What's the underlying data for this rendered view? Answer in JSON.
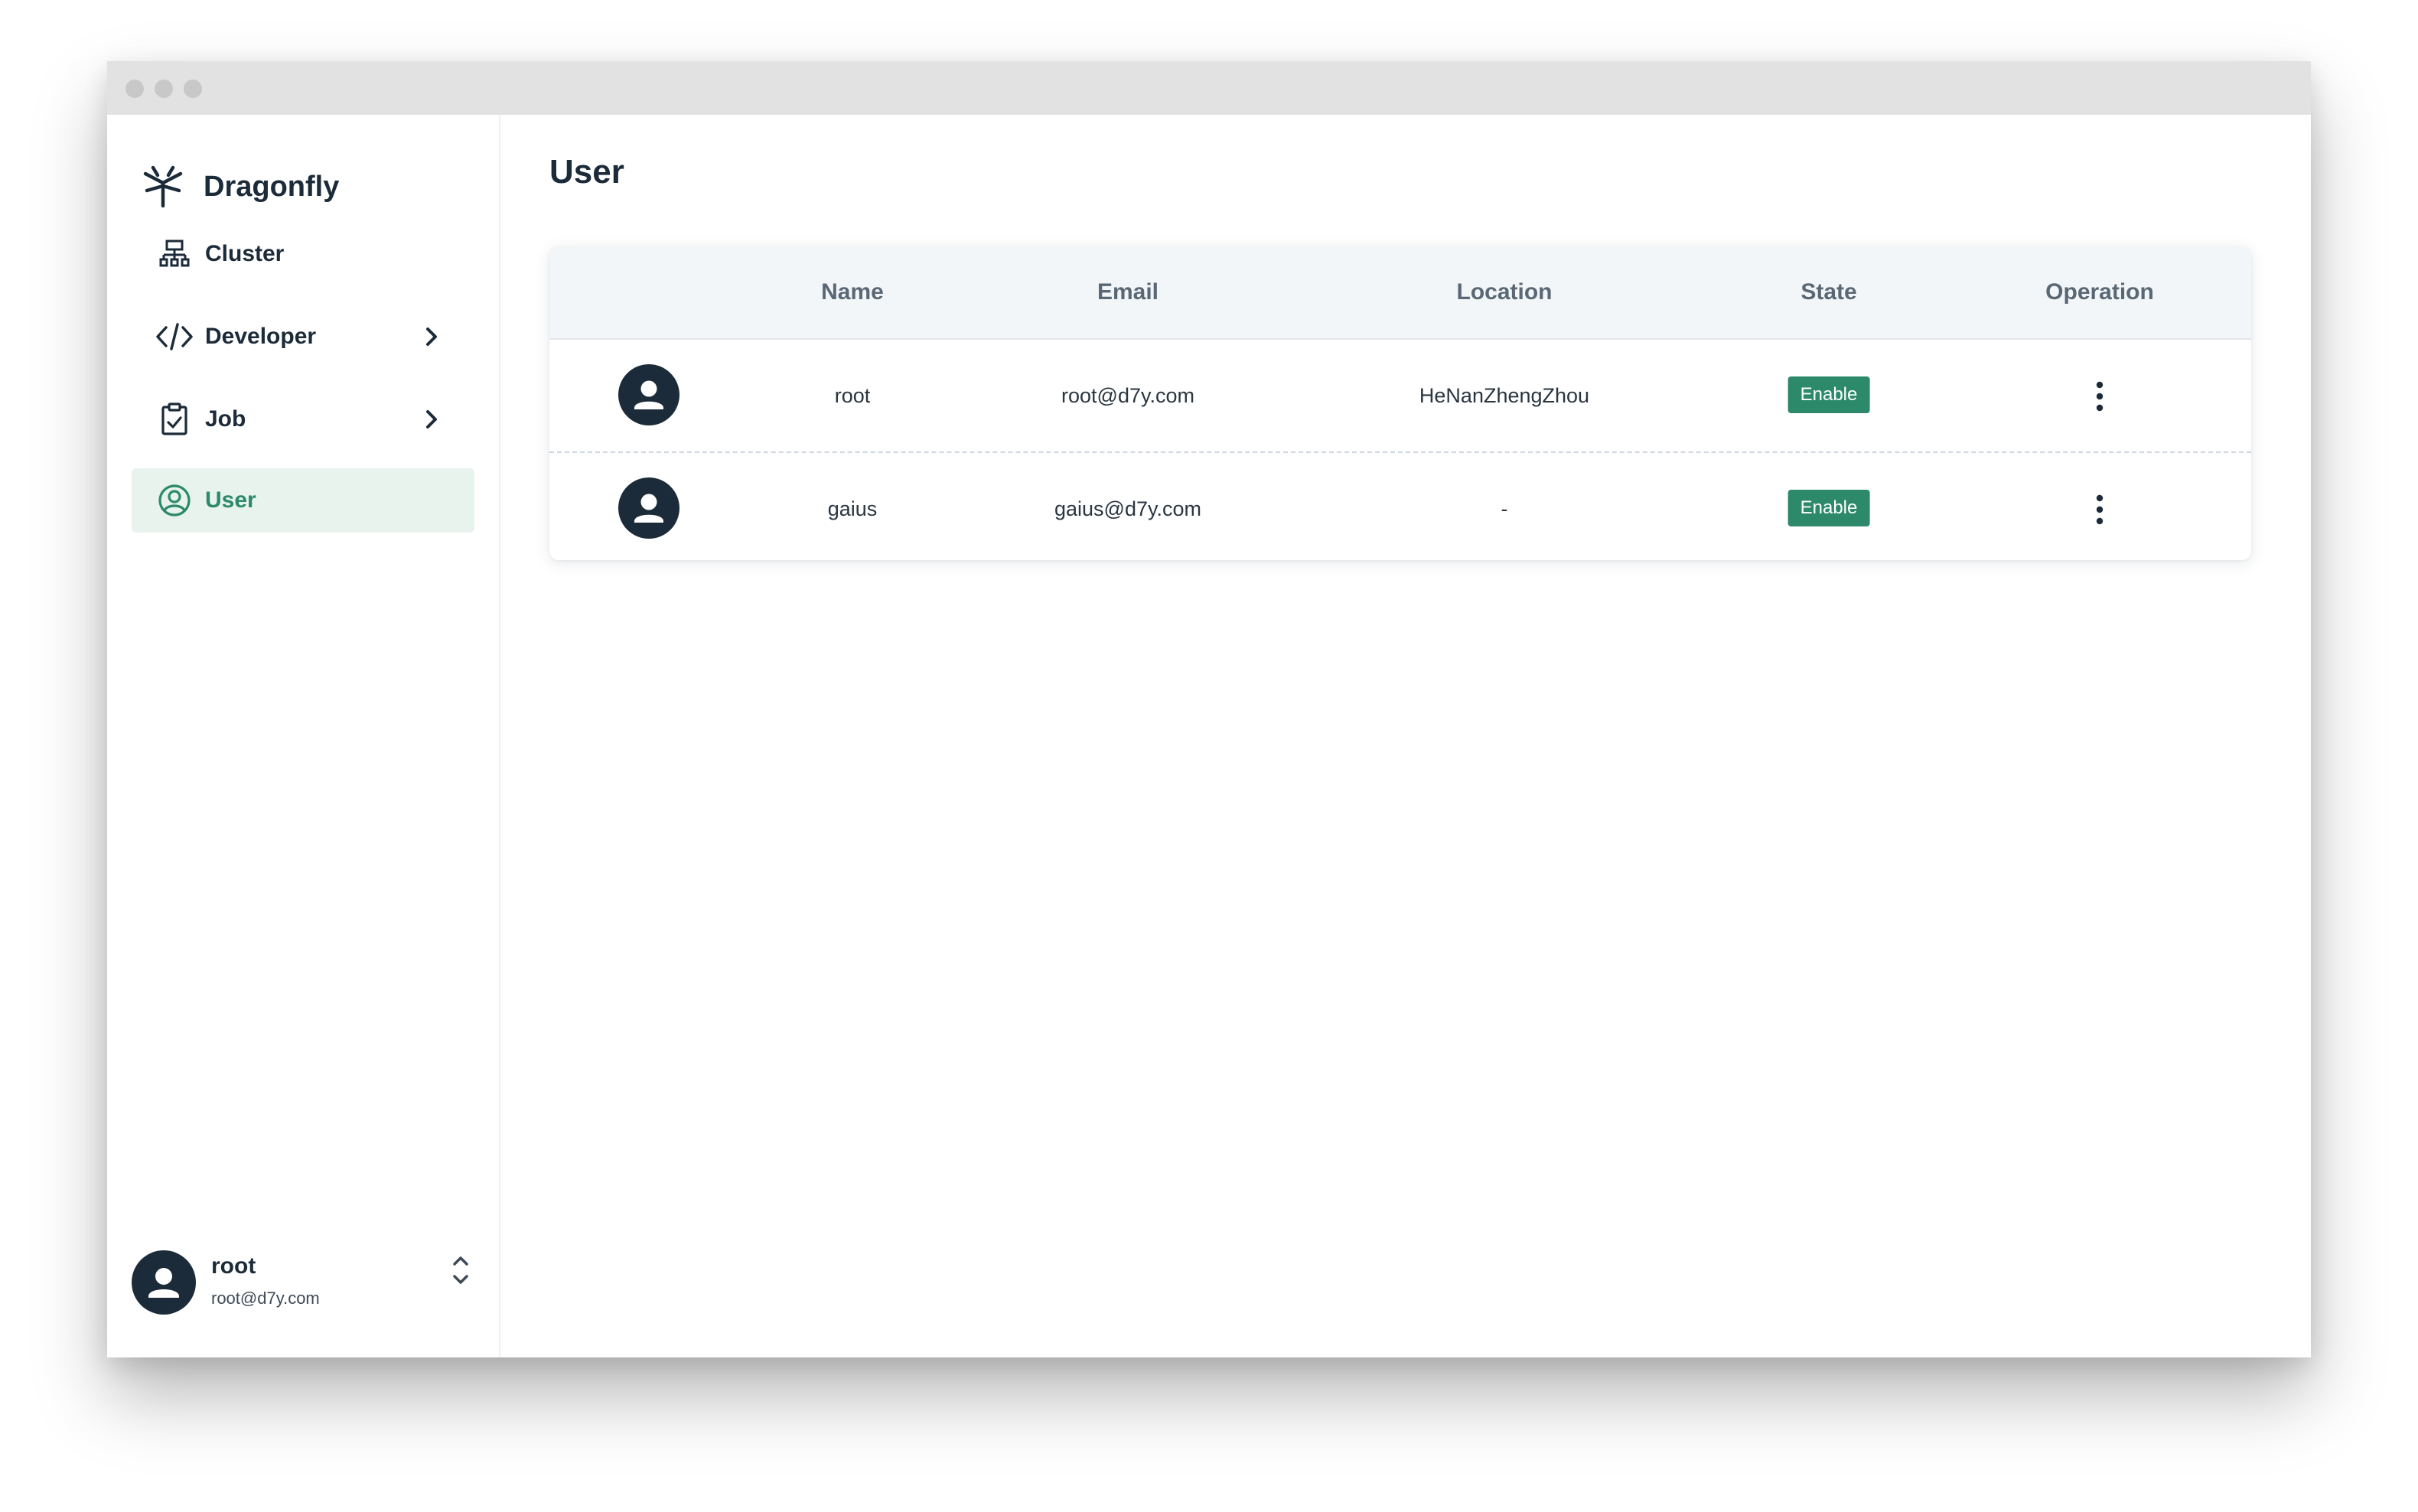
{
  "app": {
    "brand_name": "Dragonfly",
    "accent_color": "#2c8a6b",
    "dark_color": "#1c2b39"
  },
  "sidebar": {
    "items": [
      {
        "label": "Cluster",
        "icon": "cluster-icon"
      },
      {
        "label": "Developer",
        "icon": "code-icon",
        "expandable": true
      },
      {
        "label": "Job",
        "icon": "clipboard-icon",
        "expandable": true
      },
      {
        "label": "User",
        "icon": "user-circle-icon",
        "active": true
      }
    ],
    "current_user": {
      "name": "root",
      "email": "root@d7y.com"
    }
  },
  "main": {
    "title": "User",
    "table": {
      "columns": [
        "Name",
        "Email",
        "Location",
        "State",
        "Operation"
      ],
      "rows": [
        {
          "name": "root",
          "email": "root@d7y.com",
          "location": "HeNanZhengZhou",
          "state": "Enable"
        },
        {
          "name": "gaius",
          "email": "gaius@d7y.com",
          "location": "-",
          "state": "Enable"
        }
      ]
    }
  }
}
